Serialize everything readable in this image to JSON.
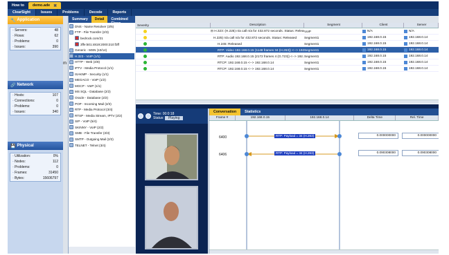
{
  "tabs": [
    "How to",
    "demo.ade"
  ],
  "nav": [
    "ClearSight",
    "Issues",
    "Problems",
    "Decode",
    "Reports"
  ],
  "subtabs": [
    "Summary",
    "Detail",
    "Combined Flows"
  ],
  "left": {
    "sections": [
      {
        "title": "Application",
        "items": [
          [
            "Servers:",
            "48"
          ],
          [
            "Flows:",
            "62"
          ],
          [
            "Problems:",
            "0"
          ],
          [
            "Issues:",
            "390"
          ]
        ]
      },
      {
        "title": "Network",
        "items": [
          [
            "Hosts:",
            "107"
          ],
          [
            "Connections:",
            "0"
          ],
          [
            "Problems:",
            "0"
          ],
          [
            "Issues:",
            "340"
          ]
        ]
      },
      {
        "title": "Physical",
        "items": [
          [
            "Utilization:",
            "0%"
          ],
          [
            "Nodes:",
            "112"
          ],
          [
            "Problems:",
            "0"
          ],
          [
            "Frames:",
            "31450"
          ],
          [
            "Bytes:",
            "15606797"
          ]
        ]
      }
    ],
    "cutoff": "m"
  },
  "protocols": [
    "DNS - Name Resolver (3/5)",
    "FTP - File Transfer (2/3)",
    "bedrock.com/21",
    "3ffe:501:4819:2000:210:f3ff",
    "Generic - MSN (10/14)",
    "H.323 - VoIP (1/1)",
    "HTTP - Web (4/8)",
    "IPTV - Media Protocol (1/1)",
    "ISAKMP - Security (1/1)",
    "MEGACO - VoIP (1/2)",
    "MGCP - VoIP (1/1)",
    "MS SQL - Database (2/2)",
    "Oracle - Database (2/2)",
    "POP - Incoming Mail (2/3)",
    "RTP - Media Protocol (3/4)",
    "RTSP - Media Stream, IPTV (2/2)",
    "SIP - VoIP (5/4)",
    "SKINNY - VoIP (2/2)",
    "SMB - File Transfer (3/3)",
    "SMTP - Outgoing Mail (2/2)",
    "TELNET - Telnet (3/4)"
  ],
  "table": {
    "headers": [
      "Severity",
      "Description",
      "Segment",
      "Client",
      "Server"
    ],
    "rows": [
      [
        "yellow",
        "⊟ H.323: (H.225) n/a call n/a for 432.872 seconds. Status: Released",
        "VoIP",
        "N/A",
        "N/A"
      ],
      [
        "yellow",
        "H.225) n/a call n/a for 432.872 seconds. Status: Released",
        "Segment1",
        "192.168.0.15",
        "192.168.0.14"
      ],
      [
        "green",
        "H.245: Released",
        "Segment1",
        "192.168.0.15",
        "192.168.0.14"
      ],
      [
        "green",
        "RTP: Video 192.168.0.15 (1148 frames 34 (H.263)) <--> 192.168.0.14 (Segment1",
        "Segment1",
        "192.168.0.15",
        "192.168.0.14"
      ],
      [
        "green",
        "RTP: Audio 192.168.0.15 (2172 frames 4 (G.723)) <--> 192.168.0.14 (Segment1",
        "Segment1",
        "192.168.0.15",
        "192.168.0.14"
      ],
      [
        "green",
        "RTCP: 192.168.0.15 <--> 192.168.0.14",
        "Segment1",
        "192.168.0.15",
        "192.168.0.14"
      ],
      [
        "green",
        "RTCP: 192.168.0.15 <--> 192.168.0.14",
        "Segment1",
        "192.168.0.15",
        "192.168.0.14"
      ]
    ]
  },
  "video": {
    "time_label": "Time:",
    "time": "00:0:18",
    "status_label": "Status:",
    "status": "Playing"
  },
  "conversation": {
    "tabs": [
      "Conversation",
      "Statistics"
    ],
    "headers": [
      "Frame #",
      "192.168.0.15",
      "192.168.0.14",
      "Delta Time",
      "Rel. Time"
    ],
    "rows": [
      {
        "frame": "6400",
        "payload": "RTP: Payload = 34 (H.263)",
        "delta": "0.000000000",
        "rel": "0.000000000"
      },
      {
        "frame": "6406",
        "payload": "RTP: Payload = 34 (H.263)",
        "delta": "0.090308000",
        "rel": "0.090308000"
      }
    ]
  }
}
